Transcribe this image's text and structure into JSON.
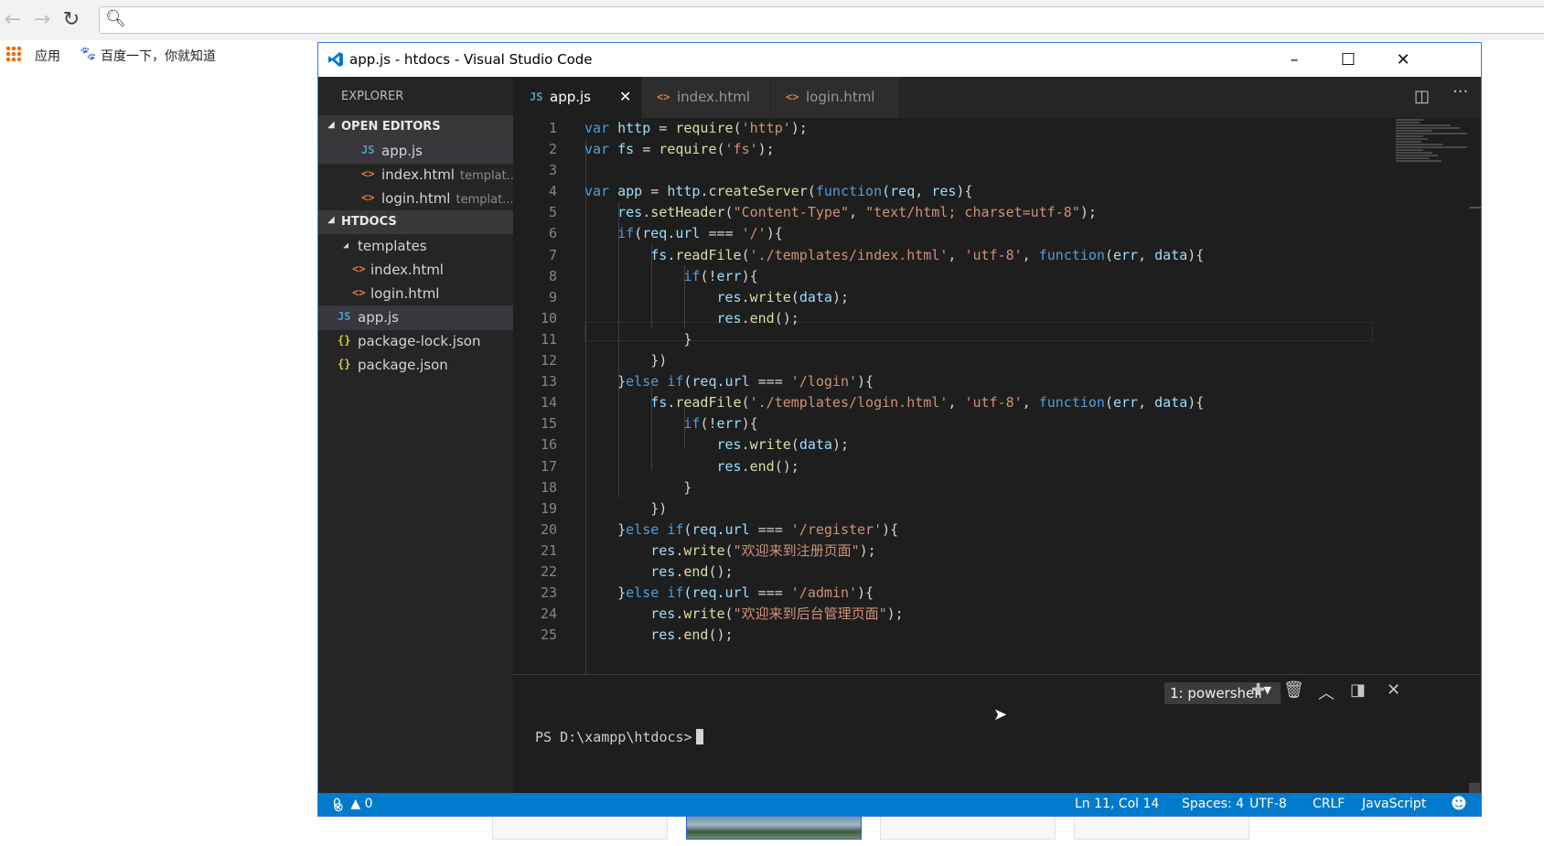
{
  "browser": {
    "bookmarks": {
      "apps": "应用",
      "baidu": "百度一下，你就知道"
    }
  },
  "window": {
    "title": "app.js - htdocs - Visual Studio Code",
    "controls": {
      "minimize": "–",
      "maximize": "☐",
      "close": "✕"
    }
  },
  "sidebar": {
    "title": "EXPLORER",
    "open_editors": {
      "label": "OPEN EDITORS",
      "items": [
        {
          "icon": "JS",
          "name": "app.js",
          "desc": ""
        },
        {
          "icon": "<>",
          "name": "index.html",
          "desc": "templat..."
        },
        {
          "icon": "<>",
          "name": "login.html",
          "desc": "templat..."
        }
      ]
    },
    "htdocs": {
      "label": "HTDOCS",
      "folder": "templates",
      "items": [
        {
          "icon": "<>",
          "name": "index.html"
        },
        {
          "icon": "<>",
          "name": "login.html"
        },
        {
          "icon": "JS",
          "name": "app.js"
        },
        {
          "icon": "{}",
          "name": "package-lock.json"
        },
        {
          "icon": "{}",
          "name": "package.json"
        }
      ]
    }
  },
  "tabs": [
    {
      "icon": "JS",
      "name": "app.js",
      "close": "✕"
    },
    {
      "icon": "<>",
      "name": "index.html"
    },
    {
      "icon": "<>",
      "name": "login.html"
    }
  ],
  "editor": {
    "line_numbers": [
      "1",
      "2",
      "3",
      "4",
      "5",
      "6",
      "7",
      "8",
      "9",
      "10",
      "11",
      "12",
      "13",
      "14",
      "15",
      "16",
      "17",
      "18",
      "19",
      "20",
      "21",
      "22",
      "23",
      "24",
      "25"
    ]
  },
  "terminal": {
    "selected": "1: powershell",
    "prompt": "PS D:\\xampp\\htdocs>"
  },
  "status": {
    "errors": "0",
    "warnings": "0",
    "position": "Ln 11, Col 14",
    "spaces": "Spaces: 4",
    "encoding": "UTF-8",
    "eol": "CRLF",
    "language": "JavaScript"
  },
  "colors": {
    "statusbar": "#007acc",
    "editor_bg": "#1e1e1e",
    "sidebar_bg": "#252526",
    "keyword": "#569cd6",
    "function": "#dcdcaa",
    "string": "#ce9178",
    "variable": "#9cdcfe"
  }
}
